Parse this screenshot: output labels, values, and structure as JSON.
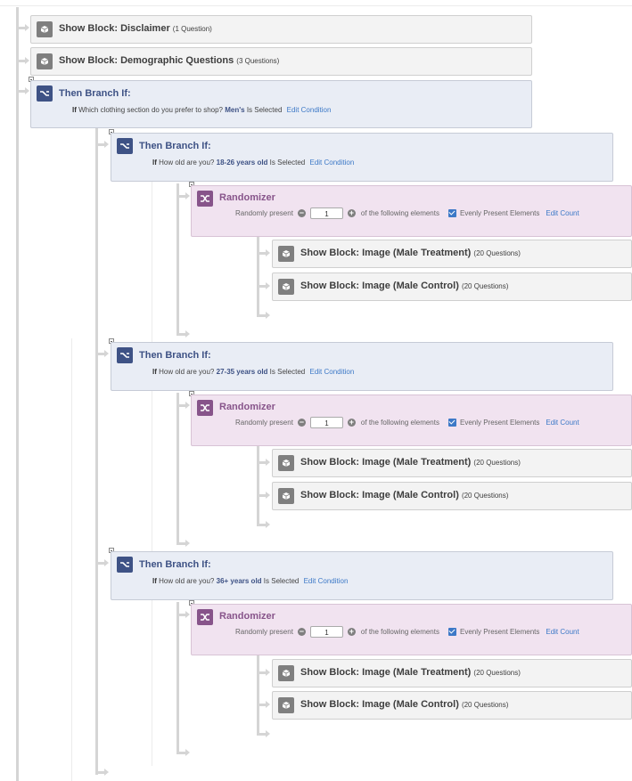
{
  "show_label": "Show Block:",
  "then_branch_label": "Then Branch If:",
  "if_label": "If",
  "is_selected": "Is Selected",
  "edit_condition": "Edit Condition",
  "randomizer_label": "Randomizer",
  "randomly_present": "Randomly present",
  "following": "of the following elements",
  "evenly": "Evenly Present Elements",
  "edit_count": "Edit Count",
  "blocks": {
    "disclaimer": {
      "name": "Disclaimer",
      "count": "(1 Question)"
    },
    "demographic": {
      "name": "Demographic Questions",
      "count": "(3 Questions)"
    }
  },
  "top_branch": {
    "question": "Which clothing section do you prefer to shop?",
    "answer": "Men's"
  },
  "age_branches": [
    {
      "question": "How old are you?",
      "answer": "18-26 years old",
      "randomizer_count": "1",
      "blocks": [
        {
          "name": "Image (Male Treatment)",
          "count": "(20 Questions)"
        },
        {
          "name": "Image (Male Control)",
          "count": "(20 Questions)"
        }
      ]
    },
    {
      "question": "How old are you?",
      "answer": "27-35 years old",
      "randomizer_count": "1",
      "blocks": [
        {
          "name": "Image (Male Treatment)",
          "count": "(20 Questions)"
        },
        {
          "name": "Image (Male Control)",
          "count": "(20 Questions)"
        }
      ]
    },
    {
      "question": "How old are you?",
      "answer": "36+ years old",
      "randomizer_count": "1",
      "blocks": [
        {
          "name": "Image (Male Treatment)",
          "count": "(20 Questions)"
        },
        {
          "name": "Image (Male Control)",
          "count": "(20 Questions)"
        }
      ]
    }
  ]
}
